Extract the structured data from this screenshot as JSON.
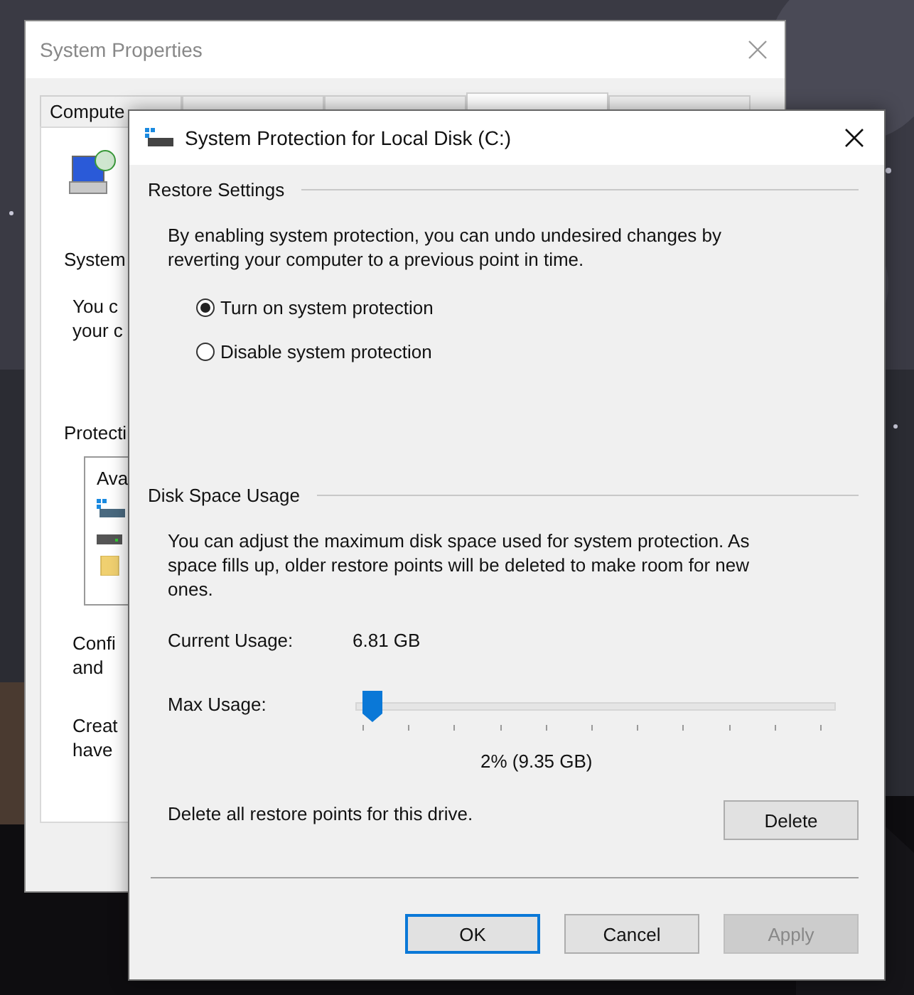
{
  "back_window": {
    "title": "System Properties",
    "tabs": [
      {
        "label": "Compute",
        "selected": false
      },
      {
        "selected": false
      },
      {
        "selected": false
      },
      {
        "selected": true
      },
      {
        "selected": false
      }
    ],
    "heading": "System",
    "description_lines": [
      "You c",
      "your c"
    ],
    "protection_label": "Protecti",
    "list_header": "Ava",
    "config_lines": [
      "Confi",
      "and"
    ],
    "create_lines": [
      "Creat",
      "have"
    ]
  },
  "dialog": {
    "title": "System Protection for Local Disk (C:)",
    "restore_settings": {
      "title": "Restore Settings",
      "description": "By enabling system protection, you can undo undesired changes by reverting your computer to a previous point in time.",
      "options": [
        {
          "label": "Turn on system protection",
          "selected": true
        },
        {
          "label": "Disable system protection",
          "selected": false
        }
      ]
    },
    "disk_space": {
      "title": "Disk Space Usage",
      "description": "You can adjust the maximum disk space used for system protection. As space fills up, older restore points will be deleted to make room for new ones.",
      "current_usage_label": "Current Usage:",
      "current_usage_value": "6.81 GB",
      "max_usage_label": "Max Usage:",
      "max_usage": {
        "level": 0.02
      },
      "max_usage_reading": "2% (9.35 GB)",
      "delete_text": "Delete all restore points for this drive.",
      "delete_button": "Delete"
    },
    "buttons": [
      {
        "label": "OK",
        "default": true,
        "disabled": false
      },
      {
        "label": "Cancel",
        "default": false,
        "disabled": false
      },
      {
        "label": "Apply",
        "default": false,
        "disabled": true
      }
    ]
  }
}
